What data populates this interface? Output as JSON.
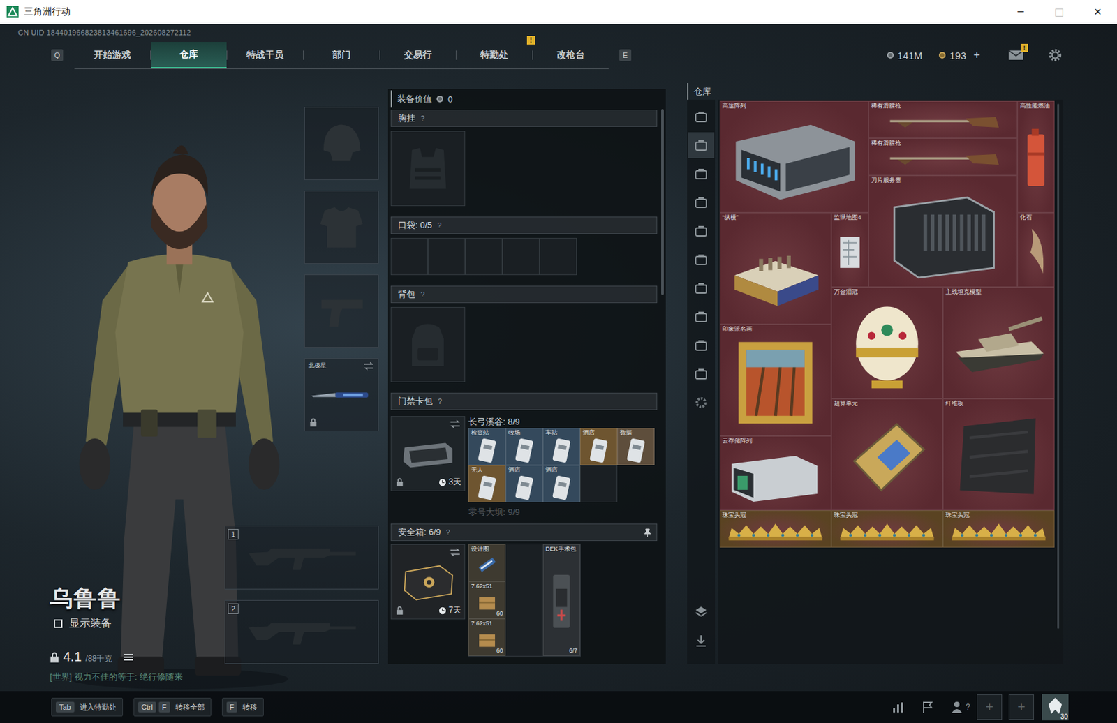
{
  "window": {
    "title": "三角洲行动",
    "controls": [
      {
        "glyph": "─",
        "disabled": false
      },
      {
        "glyph": "□",
        "disabled": true
      },
      {
        "glyph": "✕",
        "disabled": false
      }
    ]
  },
  "uid": "CN UID 184401966823813461696_202608272112",
  "nav": {
    "prev_key": "Q",
    "next_key": "E",
    "tabs": [
      {
        "label": "开始游戏",
        "selected": false,
        "badge": ""
      },
      {
        "label": "仓库",
        "selected": true,
        "badge": ""
      },
      {
        "label": "特战干员",
        "selected": false,
        "badge": ""
      },
      {
        "label": "部门",
        "selected": false,
        "badge": ""
      },
      {
        "label": "交易行",
        "selected": false,
        "badge": ""
      },
      {
        "label": "特勤处",
        "selected": false,
        "badge": "!"
      },
      {
        "label": "改枪台",
        "selected": false,
        "badge": ""
      }
    ]
  },
  "wallet": {
    "coins": "141M",
    "bonds": "193",
    "add": "+"
  },
  "mail": {
    "badge": "!"
  },
  "character": {
    "name": "乌鲁鲁",
    "show_gear": {
      "label": "显示装备",
      "checked": false
    },
    "weight": "4.1",
    "weight_max": "/88千克",
    "chat": "[世界] 视力不佳的等于: 绝行修随来"
  },
  "gear_slots": [
    {
      "kind": "helmet",
      "label": "",
      "locked": false
    },
    {
      "kind": "armor",
      "label": "",
      "locked": false
    },
    {
      "kind": "pistol",
      "label": "",
      "locked": false
    },
    {
      "kind": "melee",
      "label": "北极星",
      "locked": true
    }
  ],
  "weapon_slots": [
    {
      "number": "1"
    },
    {
      "number": "2"
    }
  ],
  "loadout": {
    "value_label": "装备价值",
    "value": "0",
    "chest_rig": {
      "title": "胸挂",
      "help": "?"
    },
    "pockets": {
      "title": "口袋: 0/5",
      "help": "?",
      "slots": [
        {
          "filled": false
        },
        {
          "filled": false
        },
        {
          "filled": false
        },
        {
          "filled": false
        },
        {
          "filled": false
        }
      ]
    },
    "backpack": {
      "title": "背包",
      "help": "?"
    },
    "keycards": {
      "title": "门禁卡包",
      "help": "?",
      "timer": "3天",
      "locked": true,
      "groups": [
        {
          "title": "长弓溪谷: 8/9",
          "faded": false,
          "empty_slots": 1,
          "cards": [
            {
              "label": "检查站",
              "color": "#34495c"
            },
            {
              "label": "牧场",
              "color": "#34495c"
            },
            {
              "label": "车站",
              "color": "#34495c"
            },
            {
              "label": "酒店",
              "color": "#6e5530"
            },
            {
              "label": "数据",
              "color": "#5e4e3c"
            },
            {
              "label": "无人",
              "color": "#6e5530"
            },
            {
              "label": "酒店",
              "color": "#34495c"
            },
            {
              "label": "酒店",
              "color": "#34495c"
            }
          ]
        },
        {
          "title": "零号大坝: 9/9",
          "faded": true,
          "empty_slots": 0,
          "cards": []
        }
      ]
    },
    "safe": {
      "title": "安全箱: 6/9",
      "help": "?",
      "timer": "7天",
      "locked": true,
      "items": [
        {
          "label": "设计图",
          "count": ""
        },
        {
          "label": "7.62x51",
          "count": "60"
        },
        {
          "label": "7.62x51",
          "count": "60"
        },
        {
          "label": "DEK手术包",
          "count": "6/7"
        }
      ]
    }
  },
  "warehouse": {
    "title": "仓库",
    "side_tabs": [
      {
        "selected": false
      },
      {
        "selected": true
      },
      {
        "selected": false
      },
      {
        "selected": false
      },
      {
        "selected": false
      },
      {
        "selected": false
      },
      {
        "selected": false
      },
      {
        "selected": false
      },
      {
        "selected": false
      },
      {
        "selected": false
      }
    ],
    "items": [
      {
        "label": "高速阵列",
        "color": "#5a2930"
      },
      {
        "label": "稀有滑膛枪",
        "color": "#5a2930"
      },
      {
        "label": "稀有滑膛枪",
        "color": "#5a2930"
      },
      {
        "label": "高性能燃油",
        "color": "#5a2930"
      },
      {
        "label": "刀片服务器",
        "color": "#5a2930"
      },
      {
        "label": "“纵横”",
        "color": "#5a2930"
      },
      {
        "label": "监狱地图4",
        "color": "#5a2930"
      },
      {
        "label": "化石",
        "color": "#5a2930"
      },
      {
        "label": "万金泪冠",
        "color": "#5a2930"
      },
      {
        "label": "主战坦克模型",
        "color": "#5a2930"
      },
      {
        "label": "印象派名画",
        "color": "#5a2930"
      },
      {
        "label": "超算单元",
        "color": "#5a2930"
      },
      {
        "label": "纤维板",
        "color": "#5a2930"
      },
      {
        "label": "云存储阵列",
        "color": "#5a2930"
      },
      {
        "label": "珠宝头冠",
        "color": "#5a4322"
      },
      {
        "label": "珠宝头冠",
        "color": "#5a4322"
      },
      {
        "label": "珠宝头冠",
        "color": "#5a4322"
      }
    ]
  },
  "bottom": {
    "hints": [
      {
        "keys": [
          "Tab"
        ],
        "label": "进入特勤处"
      },
      {
        "keys": [
          "Ctrl",
          "F"
        ],
        "label": "转移全部"
      },
      {
        "keys": [
          "F"
        ],
        "label": "转移"
      }
    ],
    "friends_count": "?",
    "squad_slots": [
      {
        "filled": false
      },
      {
        "filled": false
      }
    ],
    "squad_add": "+",
    "avatar_level": "30"
  }
}
